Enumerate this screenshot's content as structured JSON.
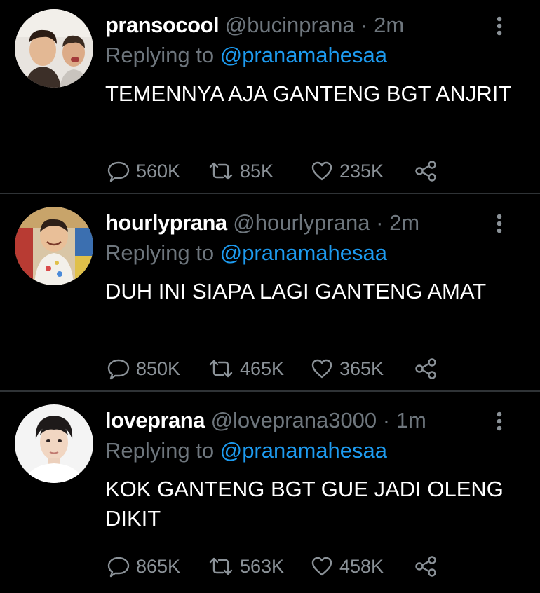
{
  "tweets": [
    {
      "display_name": "pransocool",
      "handle": "@bucinprana",
      "separator": "·",
      "time": "2m",
      "reply_prefix": "Replying to",
      "reply_to": "@pranamahesaa",
      "text": "TEMENNYA AJA GANTENG BGT ANJRIT",
      "replies": "560K",
      "retweets": "85K",
      "likes": "235K"
    },
    {
      "display_name": "hourlyprana",
      "handle": "@hourlyprana",
      "separator": "·",
      "time": "2m",
      "reply_prefix": "Replying to",
      "reply_to": "@pranamahesaa",
      "text": "DUH INI SIAPA LAGI GANTENG AMAT",
      "replies": "850K",
      "retweets": "465K",
      "likes": "365K"
    },
    {
      "display_name": "loveprana",
      "handle": "@loveprana3000",
      "separator": "·",
      "time": "1m",
      "reply_prefix": "Replying to",
      "reply_to": "@pranamahesaa",
      "text": "KOK GANTENG BGT GUE JADI OLENG DIKIT",
      "replies": "865K",
      "retweets": "563K",
      "likes": "458K"
    }
  ],
  "colors": {
    "background": "#000000",
    "text": "#ffffff",
    "muted": "#6e767d",
    "link": "#1d9bf0",
    "divider": "#2f3336",
    "icon": "#8b9298"
  },
  "icons": {
    "reply": "speech-bubble-icon",
    "retweet": "retweet-arrows-icon",
    "like": "heart-outline-icon",
    "share": "share-nodes-icon",
    "more": "vertical-ellipsis-icon"
  }
}
